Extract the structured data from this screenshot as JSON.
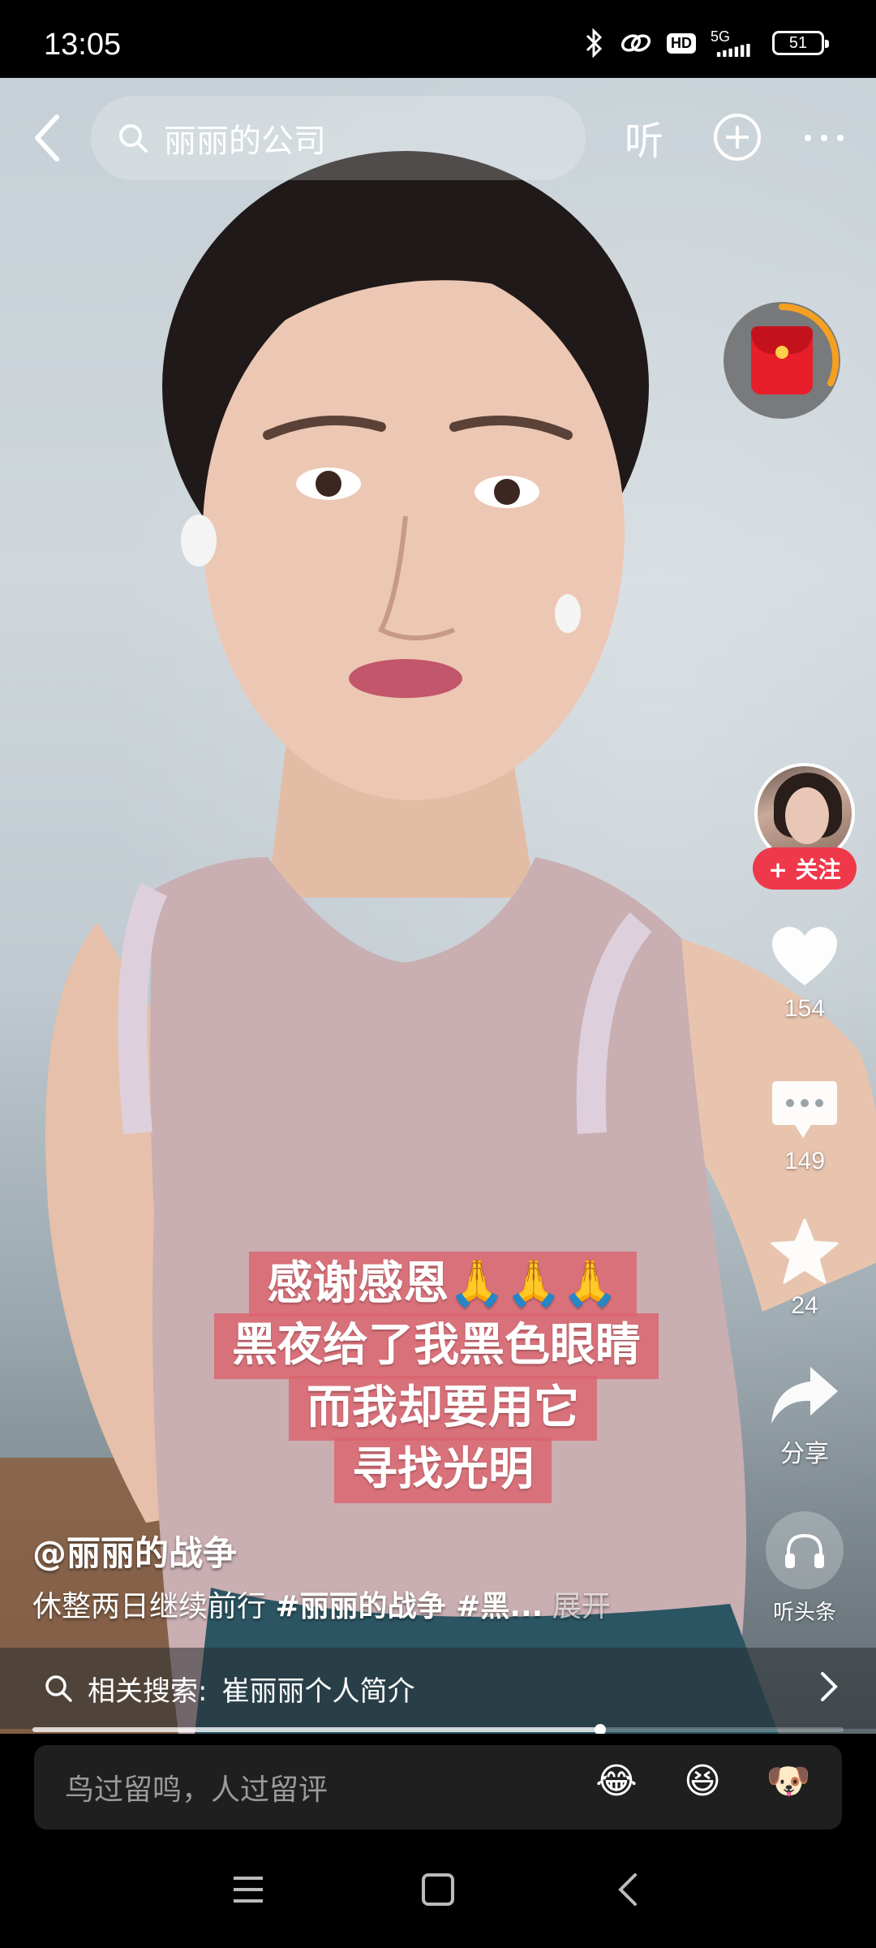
{
  "status_bar": {
    "time": "13:05",
    "network": "5G",
    "hd": "HD",
    "battery": "51",
    "icons": [
      "bluetooth-icon",
      "link-icon",
      "hd-icon",
      "signal-icon",
      "battery-icon"
    ]
  },
  "top_bar": {
    "search_text": "丽丽的公司",
    "listen_label": "听",
    "icons": [
      "back-icon",
      "search-icon",
      "plus-circle-icon",
      "more-icon"
    ]
  },
  "caption": {
    "lines": [
      "感谢感恩🙏🙏🙏",
      "黑夜给了我黑色眼睛",
      "而我却要用它",
      "寻找光明"
    ]
  },
  "right_rail": {
    "follow_label": "+ 关注",
    "likes": "154",
    "comments": "149",
    "favorites": "24",
    "share_label": "分享",
    "listen_label": "听头条"
  },
  "video_info": {
    "author": "@丽丽的战争",
    "description": "休整两日继续前行 ",
    "tag1": "#丽丽的战争",
    "tag2": " #黑...",
    "expand_label": " 展开",
    "progress": 0.7
  },
  "related_search": {
    "prefix": "相关搜索:",
    "query": "崔丽丽个人简介"
  },
  "comment_bar": {
    "placeholder": "鸟过留鸣，人过留评",
    "emojis": [
      "😂",
      "😆",
      "🐶"
    ]
  },
  "colors": {
    "accent_red": "#f0384b",
    "caption_bg": "#dc646e",
    "red_packet": "#e81e2a",
    "ring_orange": "#f5a021"
  }
}
